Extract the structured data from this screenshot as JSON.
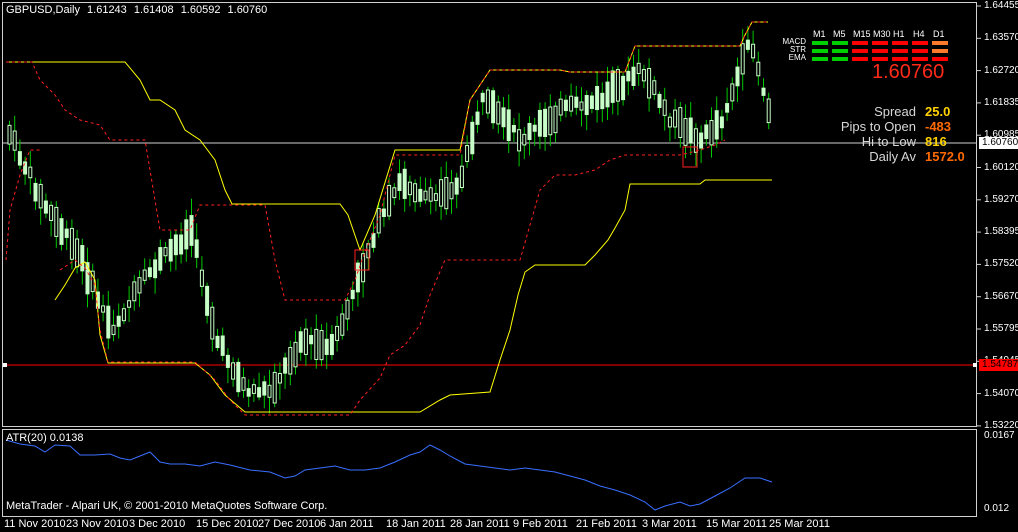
{
  "header": {
    "symbol": "GBPUSD,Daily",
    "open": "1.61243",
    "high": "1.61408",
    "low": "1.60592",
    "close": "1.60760"
  },
  "price_axis": [
    "1.64455",
    "1.63570",
    "1.62720",
    "1.61835",
    "1.60985",
    "1.60120",
    "1.59270",
    "1.58395",
    "1.57520",
    "1.56670",
    "1.55795",
    "1.54945",
    "1.54070",
    "1.53220"
  ],
  "current_price_tag": "1.60760",
  "line_price_tag": "1.54787",
  "atr": {
    "label": "ATR(20) 0.0138",
    "axis_top": "0.0167",
    "axis_bottom": "0.012"
  },
  "copyright": "MetaTrader - Alpari UK, © 2001-2010 MetaQuotes Software Corp.",
  "time_axis": [
    "11 Nov 2010",
    "23 Nov 2010",
    "3 Dec 2010",
    "15 Dec 2010",
    "27 Dec 2010",
    "6 Jan 2011",
    "18 Jan 2011",
    "28 Jan 2011",
    "9 Feb 2011",
    "21 Feb 2011",
    "3 Mar 2011",
    "15 Mar 2011",
    "25 Mar 2011"
  ],
  "panel": {
    "timeframes": [
      "M1",
      "M5",
      "M15",
      "M30",
      "H1",
      "H4",
      "D1"
    ],
    "rows": [
      {
        "label": "MACD",
        "colors": [
          "green",
          "green",
          "red",
          "red",
          "red",
          "red",
          "orange"
        ]
      },
      {
        "label": "STR",
        "colors": [
          "green",
          "green",
          "red",
          "red",
          "red",
          "red",
          "orange"
        ]
      },
      {
        "label": "EMA",
        "colors": [
          "green",
          "green",
          "red",
          "red",
          "red",
          "red",
          "red"
        ]
      }
    ],
    "big_price": "1.60760",
    "info": [
      {
        "label": "Spread",
        "value": "25.0",
        "color": "#ffd200"
      },
      {
        "label": "Pips to Open",
        "value": "-483",
        "color": "#ff6a00"
      },
      {
        "label": "Hi to Low",
        "value": "816",
        "color": "#ffd200"
      },
      {
        "label": "Daily Av",
        "value": "1572.0",
        "color": "#ff6a00"
      }
    ]
  },
  "colors": {
    "candle": "#c8ffc8",
    "wick": "#00c800",
    "upper_band": "#ffff00",
    "stop_line": "#ff2020",
    "atr_line": "#3a6fff",
    "green": "#00d000",
    "red": "#ff0000",
    "orange": "#ff7a2a"
  },
  "chart_data": {
    "type": "candlestick",
    "price_range": [
      1.5322,
      1.6446
    ],
    "atr_range": [
      0.012,
      0.0167
    ],
    "atr_current": 0.0138
  }
}
